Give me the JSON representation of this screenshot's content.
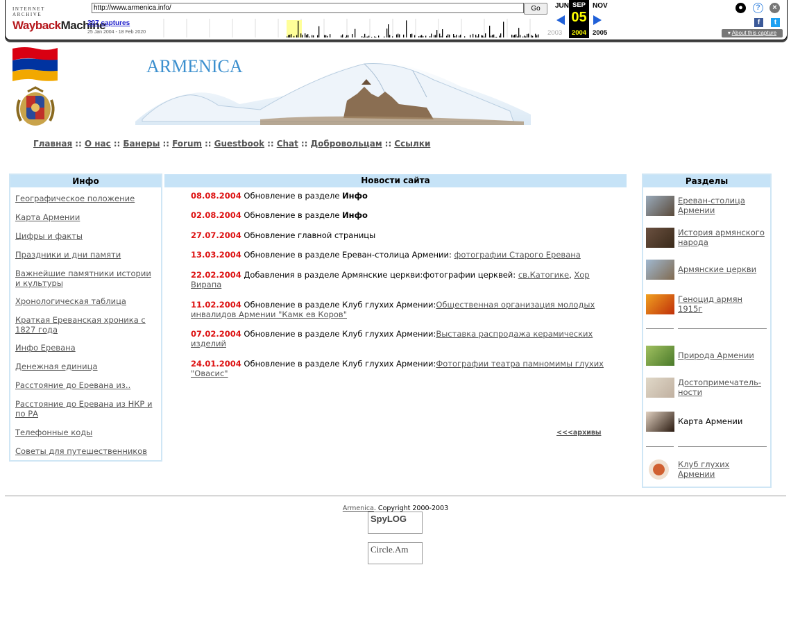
{
  "wayback": {
    "logo_top": "INTERNET ARCHIVE",
    "logo_main_1": "Wayback",
    "logo_main_2": "Machine",
    "url": "http://www.armenica.info/",
    "go_label": "Go",
    "captures": "207 captures",
    "range": "25 Jan 2004 - 18 Feb 2020",
    "month_prev": "JUN",
    "month_sel": "SEP",
    "month_next": "NOV",
    "day": "05",
    "year_prev": "2003",
    "year_sel": "2004",
    "year_next": "2005",
    "about": "About this capture",
    "icons": [
      "user-icon",
      "help-icon",
      "close-icon",
      "facebook-icon",
      "twitter-icon"
    ],
    "accent": "#2060d8"
  },
  "site": {
    "title": "ARMENICA",
    "nav": [
      "Главная",
      "О нас",
      "Банеры",
      "Forum",
      "Guestbook",
      "Chat",
      "Добровольцам",
      "Ссылки"
    ],
    "nav_sep": "::"
  },
  "left": {
    "heading": "Инфо",
    "items": [
      "Географическое положение",
      "Карта Армении",
      "Цифры и факты",
      "Праздники и дни памяти",
      "Важнейшие памятники истории и культуры",
      "Хронологическая таблица",
      "Краткая Ереванская хроника с 1827 года",
      "Инфо Еревана",
      "Денежная единица",
      "Расстояние до Еревана из..",
      "Расстояние до Еревана из НКР и по РА",
      "Телефонные коды",
      "Советы для путешественников"
    ]
  },
  "news": {
    "heading": "Новости сайта",
    "items": [
      {
        "date": "08.08.2004",
        "text": "Обновление в разделе ",
        "bold": "Инфо",
        "link": "",
        "link2": ""
      },
      {
        "date": "02.08.2004",
        "text": "Обновление в разделе ",
        "bold": "Инфо",
        "link": "",
        "link2": ""
      },
      {
        "date": "27.07.2004",
        "text": "Обновление главной страницы",
        "bold": "",
        "link": "",
        "link2": ""
      },
      {
        "date": "13.03.2004",
        "text": "Обновление в разделе Ереван-столица Армении: ",
        "bold": "",
        "link": "фотографии Старого Еревана",
        "link2": ""
      },
      {
        "date": "22.02.2004",
        "text": "Добавления в разделе Армянские церкви:фотографии церквей: ",
        "bold": "",
        "link": "св.Катогике",
        "link2": "Хор Вирапа"
      },
      {
        "date": "11.02.2004",
        "text": "Обновление в разделе Клуб глухих Армении:",
        "bold": "",
        "link": "Общественная организация молодых инвалидов Армении \"Камк ев Коров\"",
        "link2": ""
      },
      {
        "date": "07.02.2004",
        "text": "Обновление в разделе Клуб глухих Армении:",
        "bold": "",
        "link": "Выставка распродажа керамических изделий",
        "link2": ""
      },
      {
        "date": "24.01.2004",
        "text": "Обновление в разделе Клуб глухих Армении:",
        "bold": "",
        "link": "Фотографии театра памномимы глухих \"Овасис\"",
        "link2": ""
      }
    ],
    "archive": "<<<архивы"
  },
  "right": {
    "heading": "Разделы",
    "items": [
      {
        "label": "Ереван-столица Армении",
        "link": true
      },
      {
        "label": "История армянского народа",
        "link": true
      },
      {
        "label": "Армянские церкви",
        "link": true
      },
      {
        "label": "Геноцид армян 1915г",
        "link": true
      },
      {
        "label": "Природа Армении",
        "link": true
      },
      {
        "label": "Достопримечатель-ности",
        "link": true
      },
      {
        "label": "Карта Армении",
        "link": false
      },
      {
        "label": "Клуб глухих Армении",
        "link": true
      }
    ]
  },
  "footer": {
    "site_link": "Armenica",
    "copyright": ". Copyright 2000-2003",
    "counter1": "SpyLOG",
    "counter2": "Circle.Am"
  }
}
